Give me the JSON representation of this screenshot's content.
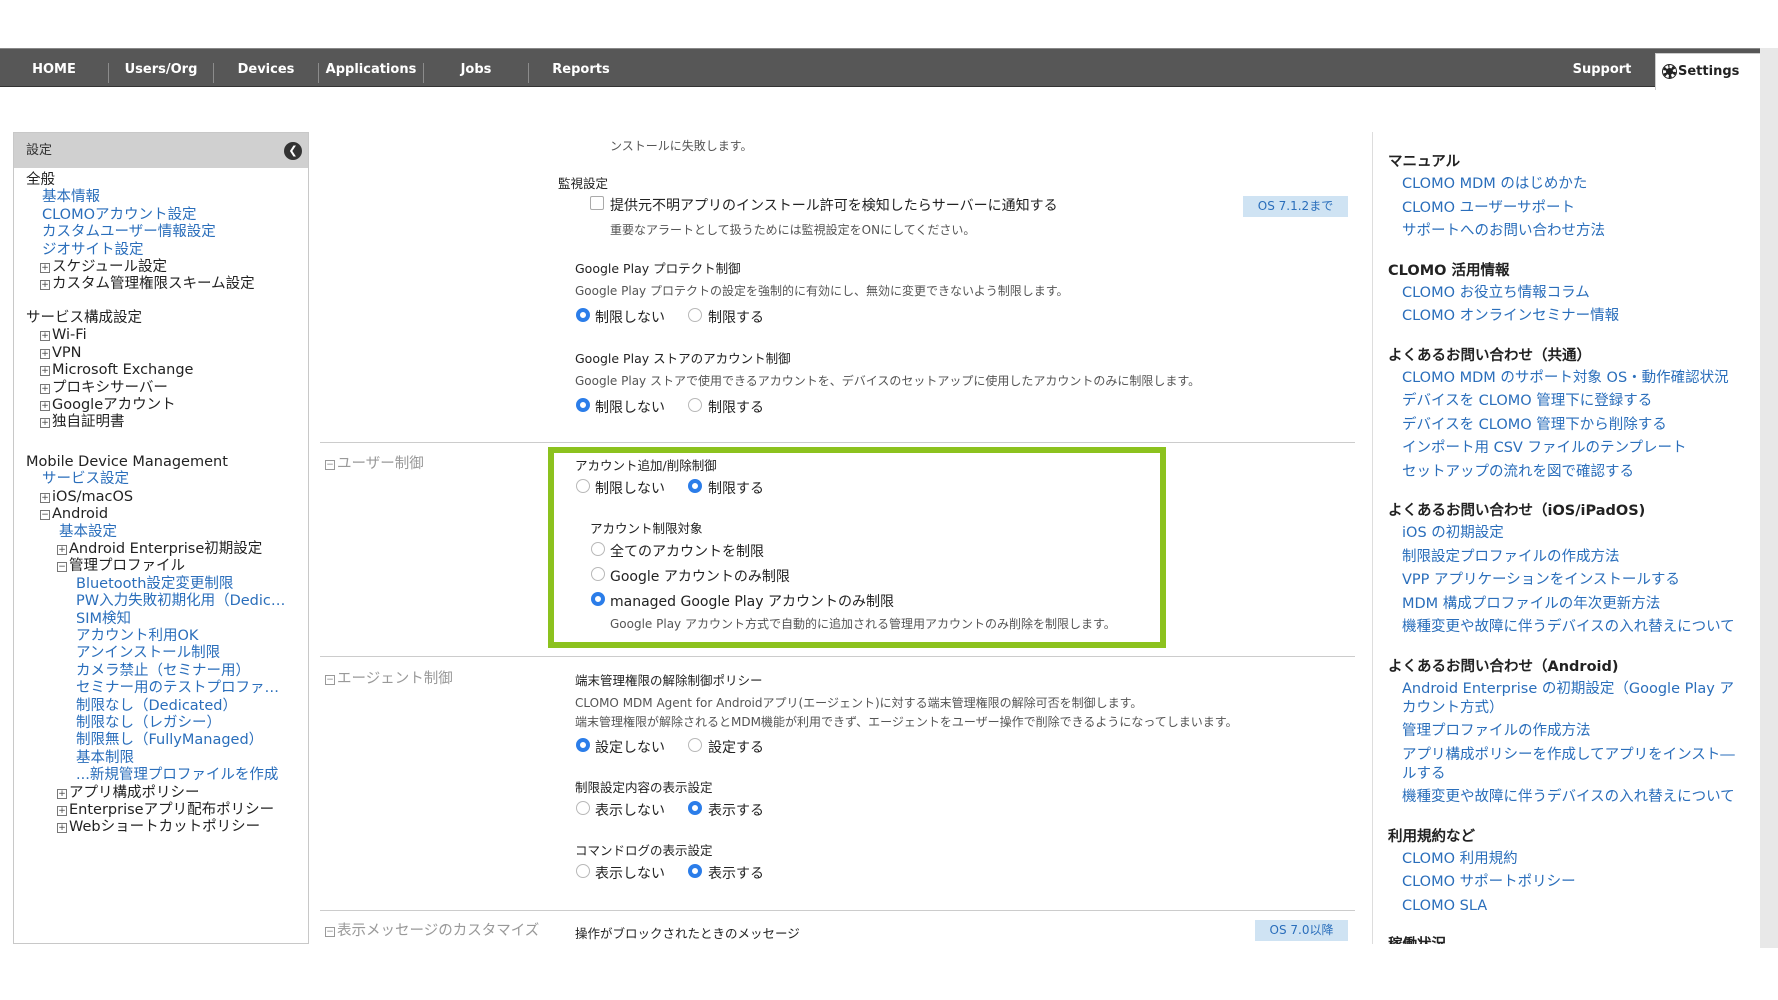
{
  "nav": {
    "items": [
      "HOME",
      "Users/Org",
      "Devices",
      "Applications",
      "Jobs",
      "Reports"
    ],
    "support": "Support",
    "settings": "Settings"
  },
  "sidebar": {
    "title": "設定",
    "collapse_icon": "chevron-left-icon",
    "groups": [
      {
        "title": "全般",
        "items": [
          {
            "label": "基本情報",
            "type": "link",
            "indent": 1
          },
          {
            "label": "CLOMOアカウント設定",
            "type": "link",
            "indent": 1
          },
          {
            "label": "カスタムユーザー情報設定",
            "type": "link",
            "indent": 1
          },
          {
            "label": "ジオサイト設定",
            "type": "link",
            "indent": 1
          },
          {
            "label": "スケジュール設定",
            "type": "tree",
            "indent": 1
          },
          {
            "label": "カスタム管理権限スキーム設定",
            "type": "tree",
            "indent": 1
          }
        ]
      },
      {
        "title": "サービス構成設定",
        "items": [
          {
            "label": "Wi-Fi",
            "type": "tree",
            "indent": 1
          },
          {
            "label": "VPN",
            "type": "tree",
            "indent": 1
          },
          {
            "label": "Microsoft Exchange",
            "type": "tree",
            "indent": 1
          },
          {
            "label": "プロキシサーバー",
            "type": "tree",
            "indent": 1
          },
          {
            "label": "Googleアカウント",
            "type": "tree",
            "indent": 1
          },
          {
            "label": "独自証明書",
            "type": "tree",
            "indent": 1
          }
        ]
      },
      {
        "title": "Mobile Device Management",
        "items": [
          {
            "label": "サービス設定",
            "type": "link",
            "indent": 1
          },
          {
            "label": "iOS/macOS",
            "type": "tree",
            "indent": 1
          },
          {
            "label": "Android",
            "type": "tree-open",
            "indent": 1
          },
          {
            "label": "基本設定",
            "type": "link",
            "indent": 2
          },
          {
            "label": "Android Enterprise初期設定",
            "type": "tree",
            "indent": 2
          },
          {
            "label": "管理プロファイル",
            "type": "tree-open",
            "indent": 2
          },
          {
            "label": "Bluetooth設定変更制限",
            "type": "link",
            "indent": 3
          },
          {
            "label": "PW入力失敗初期化用（Dedic…",
            "type": "link",
            "indent": 3
          },
          {
            "label": "SIM検知",
            "type": "link",
            "indent": 3
          },
          {
            "label": "アカウント利用OK",
            "type": "link",
            "indent": 3
          },
          {
            "label": "アンインストール制限",
            "type": "link",
            "indent": 3
          },
          {
            "label": "カメラ禁止（セミナー用）",
            "type": "link",
            "indent": 3
          },
          {
            "label": "セミナー用のテストプロファ…",
            "type": "link",
            "indent": 3
          },
          {
            "label": "制限なし（Dedicated）",
            "type": "link",
            "indent": 3
          },
          {
            "label": "制限なし（レガシー）",
            "type": "link",
            "indent": 3
          },
          {
            "label": "制限無し（FullyManaged）",
            "type": "link",
            "indent": 3
          },
          {
            "label": "基本制限",
            "type": "link",
            "indent": 3
          },
          {
            "label": "...新規管理プロファイルを作成",
            "type": "link",
            "indent": 3
          },
          {
            "label": "アプリ構成ポリシー",
            "type": "tree",
            "indent": 2
          },
          {
            "label": "Enterpriseアプリ配布ポリシー",
            "type": "tree",
            "indent": 2
          },
          {
            "label": "Webショートカットポリシー",
            "type": "tree",
            "indent": 2
          }
        ]
      }
    ]
  },
  "main": {
    "top_fragment": "ンストールに失敗します。",
    "monitor": {
      "title": "監視設定",
      "checkbox_label": "提供元不明アプリのインストール許可を検知したらサーバーに通知する",
      "note": "重要なアラートとして扱うためには監視設定をONにしてください。",
      "badge": "OS 7.1.2まで"
    },
    "protect": {
      "title": "Google Play プロテクト制御",
      "desc": "Google Play プロテクトの設定を強制的に有効にし、無効に変更できないよう制限します。",
      "opt1": "制限しない",
      "opt2": "制限する",
      "selected": 1
    },
    "store": {
      "title": "Google Play ストアのアカウント制御",
      "desc": "Google Play ストアで使用できるアカウントを、デバイスのセットアップに使用したアカウントのみに制限します。",
      "opt1": "制限しない",
      "opt2": "制限する",
      "selected": 1
    },
    "user_section": {
      "name": "ユーザー制御",
      "acct": {
        "title": "アカウント追加/削除制御",
        "opt1": "制限しない",
        "opt2": "制限する",
        "selected": 2
      },
      "target": {
        "title": "アカウント制限対象",
        "opt1": "全てのアカウントを制限",
        "opt2": "Google アカウントのみ制限",
        "opt3": "managed Google Play アカウントのみ制限",
        "selected": 3,
        "note": "Google Play アカウント方式で自動的に追加される管理用アカウントのみ削除を制限します。"
      }
    },
    "agent_section": {
      "name": "エージェント制御",
      "policy": {
        "title": "端末管理権限の解除制御ポリシー",
        "desc1": "CLOMO MDM Agent for Androidアプリ(エージェント)に対する端末管理権限の解除可否を制御します。",
        "desc2": "端末管理権限が解除されるとMDM機能が利用できず、エージェントをユーザー操作で削除できるようになってしまいます。",
        "opt1": "設定しない",
        "opt2": "設定する",
        "selected": 1
      },
      "display": {
        "title": "制限設定内容の表示設定",
        "opt1": "表示しない",
        "opt2": "表示する",
        "selected": 2
      },
      "log": {
        "title": "コマンドログの表示設定",
        "opt1": "表示しない",
        "opt2": "表示する",
        "selected": 2
      }
    },
    "msg_section": {
      "name": "表示メッセージのカスタマイズ",
      "blocked_title": "操作がブロックされたときのメッセージ",
      "badge": "OS 7.0以降"
    },
    "highlight_color": "#8cc21e"
  },
  "right": {
    "sections": [
      {
        "title": "マニュアル",
        "links": [
          "CLOMO MDM のはじめかた",
          "CLOMO ユーザーサポート",
          "サポートへのお問い合わせ方法"
        ]
      },
      {
        "title": "CLOMO 活用情報",
        "links": [
          "CLOMO お役立ち情報コラム",
          "CLOMO オンラインセミナー情報"
        ]
      },
      {
        "title": "よくあるお問い合わせ（共通）",
        "links": [
          "CLOMO MDM のサポート対象 OS・動作確認状況",
          "デバイスを CLOMO 管理下に登録する",
          "デバイスを CLOMO 管理下から削除する",
          "インポート用 CSV ファイルのテンプレート",
          "セットアップの流れを図で確認する"
        ]
      },
      {
        "title": "よくあるお問い合わせ（iOS/iPadOS)",
        "links": [
          "iOS の初期設定",
          "制限設定プロファイルの作成方法",
          "VPP アプリケーションをインストールする",
          "MDM 構成プロファイルの年次更新方法",
          "機種変更や故障に伴うデバイスの入れ替えについて"
        ]
      },
      {
        "title": "よくあるお問い合わせ（Android)",
        "links": [
          "Android Enterprise の初期設定（Google Play ア|カウント方式）",
          "管理プロファイルの作成方法",
          "アプリ構成ポリシーを作成してアプリをインスト―|ルする",
          "機種変更や故障に伴うデバイスの入れ替えについて"
        ]
      },
      {
        "title": "利用規約など",
        "links": [
          "CLOMO 利用規約",
          "CLOMO サポートポリシー",
          "CLOMO SLA"
        ]
      },
      {
        "title": "稼働状況",
        "links": []
      }
    ]
  }
}
